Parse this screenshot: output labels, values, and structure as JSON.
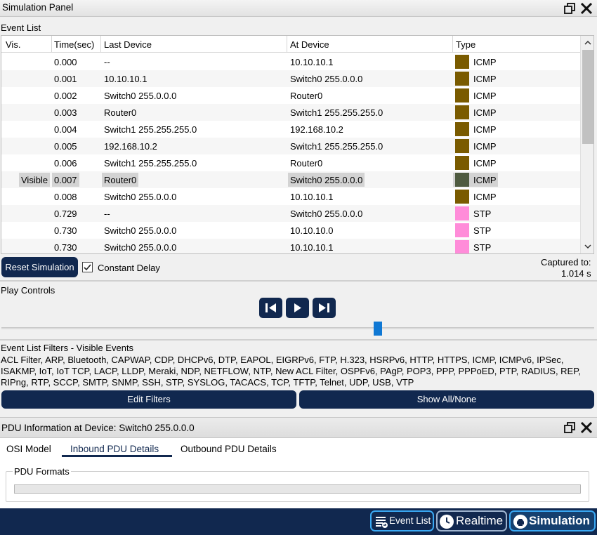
{
  "window": {
    "title": "Simulation Panel"
  },
  "event_list": {
    "label": "Event List",
    "columns": [
      "Vis.",
      "Time(sec)",
      "Last Device",
      "At Device",
      "Type"
    ],
    "rows": [
      {
        "vis": "",
        "time": "0.000",
        "last": "--",
        "at": "10.10.10.1",
        "type": "ICMP",
        "color": "#7a5b00"
      },
      {
        "vis": "",
        "time": "0.001",
        "last": "10.10.10.1",
        "at": "Switch0 255.0.0.0",
        "type": "ICMP",
        "color": "#7a5b00"
      },
      {
        "vis": "",
        "time": "0.002",
        "last": "Switch0 255.0.0.0",
        "at": "Router0",
        "type": "ICMP",
        "color": "#7a5b00"
      },
      {
        "vis": "",
        "time": "0.003",
        "last": "Router0",
        "at": "Switch1 255.255.255.0",
        "type": "ICMP",
        "color": "#7a5b00"
      },
      {
        "vis": "",
        "time": "0.004",
        "last": "Switch1 255.255.255.0",
        "at": "192.168.10.2",
        "type": "ICMP",
        "color": "#7a5b00"
      },
      {
        "vis": "",
        "time": "0.005",
        "last": "192.168.10.2",
        "at": "Switch1 255.255.255.0",
        "type": "ICMP",
        "color": "#7a5b00"
      },
      {
        "vis": "",
        "time": "0.006",
        "last": "Switch1 255.255.255.0",
        "at": "Router0",
        "type": "ICMP",
        "color": "#7a5b00"
      },
      {
        "vis": "Visible",
        "time": "0.007",
        "last": "Router0",
        "at": "Switch0 255.0.0.0",
        "type": "ICMP",
        "color": "#4f5b40",
        "selected": true
      },
      {
        "vis": "",
        "time": "0.008",
        "last": "Switch0 255.0.0.0",
        "at": "10.10.10.1",
        "type": "ICMP",
        "color": "#7a5b00"
      },
      {
        "vis": "",
        "time": "0.729",
        "last": "--",
        "at": "Switch0 255.0.0.0",
        "type": "STP",
        "color": "#ff8cd9"
      },
      {
        "vis": "",
        "time": "0.730",
        "last": "Switch0 255.0.0.0",
        "at": "10.10.10.0",
        "type": "STP",
        "color": "#ff8cd9"
      },
      {
        "vis": "",
        "time": "0.730",
        "last": "Switch0 255.0.0.0",
        "at": "10.10.10.1",
        "type": "STP",
        "color": "#ff8cd9"
      }
    ]
  },
  "controls": {
    "reset_label": "Reset Simulation",
    "constant_delay_label": "Constant Delay",
    "constant_delay_checked": true,
    "captured_label": "Captured to:",
    "captured_value": "1.014 s"
  },
  "play_controls": {
    "label": "Play Controls",
    "progress_fraction": 0.635
  },
  "filters": {
    "label": "Event List Filters - Visible Events",
    "text": "ACL Filter, ARP, Bluetooth, CAPWAP, CDP, DHCPv6, DTP, EAPOL, EIGRPv6, FTP, H.323, HSRPv6, HTTP, HTTPS, ICMP, ICMPv6, IPSec, ISAKMP, IoT, IoT TCP, LACP, LLDP, Meraki, NDP, NETFLOW, NTP, New ACL Filter, OSPFv6, PAgP, POP3, PPP, PPPoED, PTP, RADIUS, REP, RIPng, RTP, SCCP, SMTP, SNMP, SSH, STP, SYSLOG, TACACS, TCP, TFTP, Telnet, UDP, USB, VTP",
    "edit_label": "Edit Filters",
    "show_all_label": "Show All/None"
  },
  "pdu": {
    "title": "PDU Information at Device: Switch0 255.0.0.0",
    "tabs": [
      "OSI Model",
      "Inbound PDU Details",
      "Outbound PDU Details"
    ],
    "active_tab": 1,
    "formats_label": "PDU Formats"
  },
  "bottom": {
    "event_list_label": "Event List",
    "realtime_label": "Realtime",
    "simulation_label": "Simulation"
  },
  "colors": {
    "navy": "#11284f",
    "accent": "#3aa9f4",
    "icmp": "#7a5b00",
    "stp": "#ff8cd9"
  }
}
